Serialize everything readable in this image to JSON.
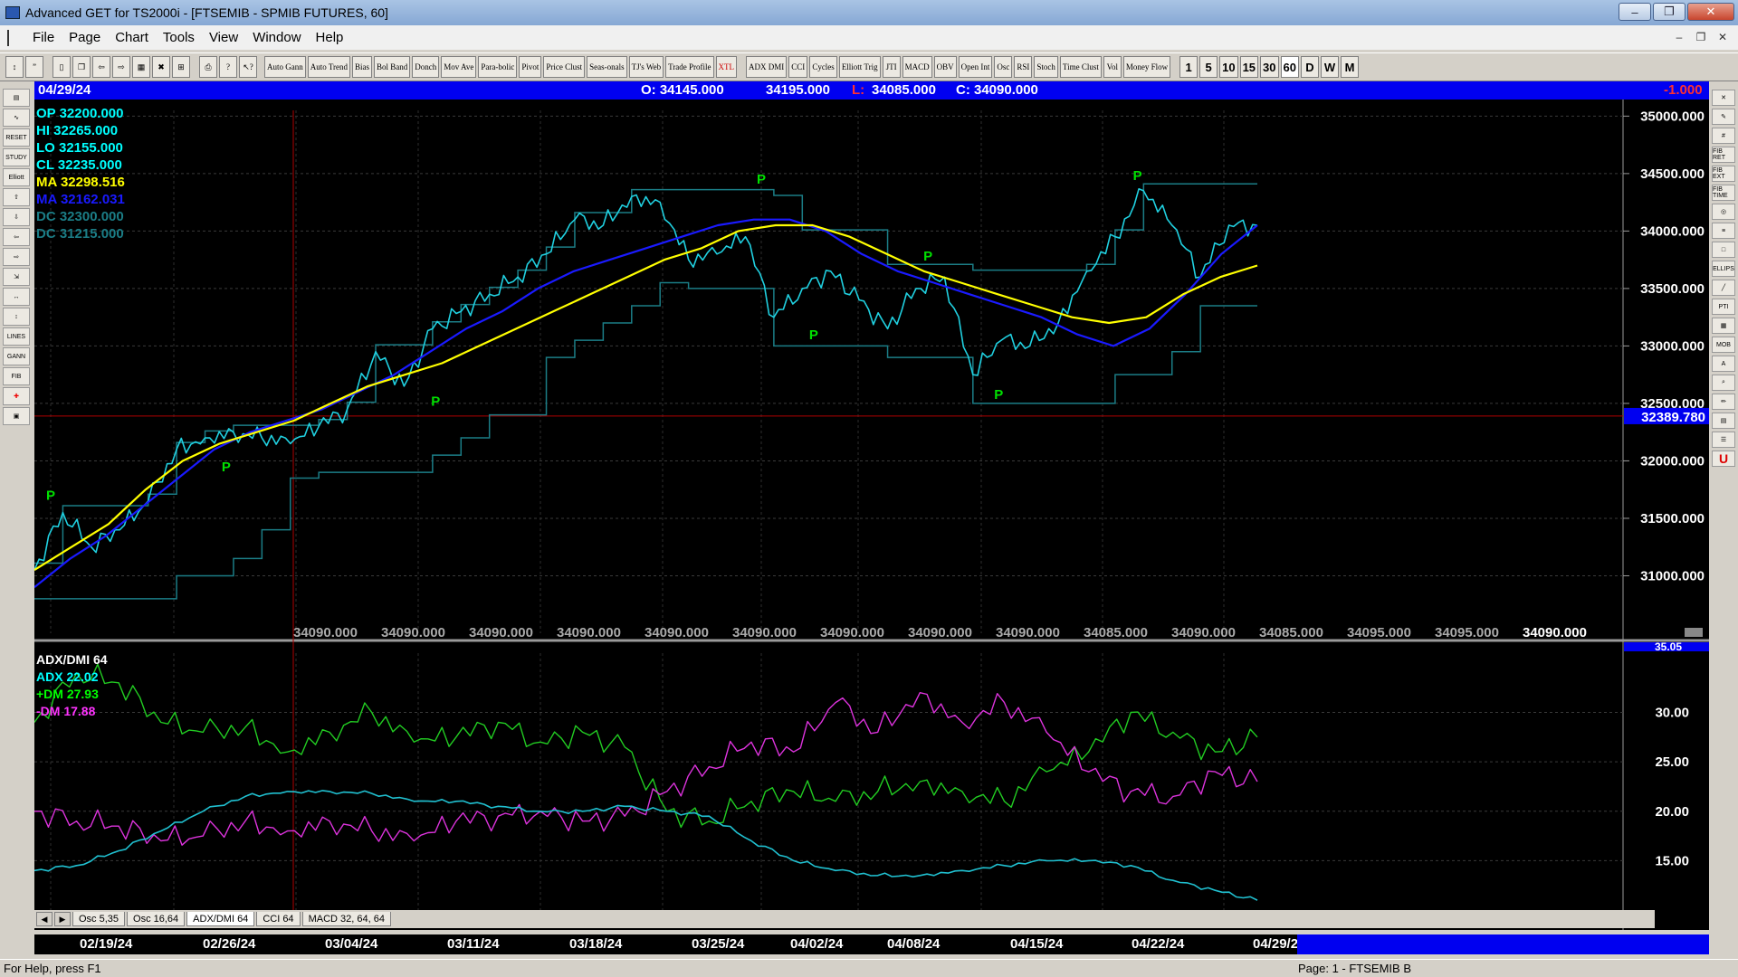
{
  "window": {
    "title": "Advanced GET for TS2000i - [FTSEMIB - SPMIB FUTURES, 60]"
  },
  "menu": [
    "File",
    "Page",
    "Chart",
    "Tools",
    "View",
    "Window",
    "Help"
  ],
  "toolbar": {
    "studies": [
      "Auto Gann",
      "Auto Trend",
      "Bias",
      "Bol Band",
      "Donch",
      "Mov Ave",
      "Para-bolic",
      "Pivot",
      "Price Clust",
      "Seas-onals",
      "TJ's Web",
      "Trade Profile",
      "XTL",
      "ADX DMI",
      "CCI",
      "Cycles",
      "Elliott Trig",
      "JTI",
      "MACD",
      "OBV",
      "Open Int",
      "Osc",
      "RSI",
      "Stoch",
      "Time Clust",
      "Vol",
      "Money Flow"
    ],
    "intervals": [
      "1",
      "5",
      "10",
      "15",
      "30",
      "60",
      "D",
      "W",
      "M"
    ],
    "active_interval": "60"
  },
  "left_tools": [
    "RESET",
    "STUDY",
    "Elliott",
    "LINES",
    "GANN",
    "FIB"
  ],
  "right_tools": [
    "FIB RET",
    "FIB EXT",
    "FIB TIME",
    "ELLIPS",
    "PTI",
    "MOB"
  ],
  "infobar": {
    "date": "04/29/24",
    "open": "O:  34145.000",
    "high": "34195.000",
    "low_label": "L:",
    "low": "34085.000",
    "close": "C:  34090.000",
    "change": "-1.000"
  },
  "legend_price": [
    {
      "label": "OP  32200.000",
      "color": "#00ffff"
    },
    {
      "label": "HI   32265.000",
      "color": "#00ffff"
    },
    {
      "label": "LO  32155.000",
      "color": "#00ffff"
    },
    {
      "label": "CL   32235.000",
      "color": "#00ffff"
    },
    {
      "label": "MA  32298.516",
      "color": "#ffff00"
    },
    {
      "label": "MA  32162.031",
      "color": "#1a1aff"
    },
    {
      "label": "DC  32300.000",
      "color": "#1b7d86"
    },
    {
      "label": "DC  31215.000",
      "color": "#1b7d86"
    }
  ],
  "price_axis": [
    "35000.000",
    "34500.000",
    "34000.000",
    "33500.000",
    "33000.000",
    "32500.000",
    "32000.000",
    "31500.000",
    "31000.000"
  ],
  "crosshair_price": "32389.780",
  "bottom_values": [
    "34090.000",
    "34090.000",
    "34090.000",
    "34090.000",
    "34090.000",
    "34090.000",
    "34090.000",
    "34090.000",
    "34090.000",
    "34085.000",
    "34090.000",
    "34085.000",
    "34095.000",
    "34095.000",
    "34090.000"
  ],
  "legend_adx": [
    {
      "label": "ADX/DMI 64",
      "color": "#ffffff"
    },
    {
      "label": "ADX 22.02",
      "color": "#00ffff"
    },
    {
      "label": "+DM 27.93",
      "color": "#00ff00"
    },
    {
      "label": "-DM  17.88",
      "color": "#ff33ff"
    }
  ],
  "adx_axis": [
    "30.00",
    "25.00",
    "20.00",
    "15.00"
  ],
  "adx_top_value": "35.05",
  "tabs": [
    "Osc 5,35",
    "Osc 16,64",
    "ADX/DMI 64",
    "CCI 64",
    "MACD 32, 64, 64"
  ],
  "active_tab": "ADX/DMI 64",
  "dates": [
    "02/19/24",
    "02/26/24",
    "03/04/24",
    "03/11/24",
    "03/18/24",
    "03/25/24",
    "04/02/24",
    "04/08/24",
    "04/15/24",
    "04/22/24",
    "04/29/24"
  ],
  "pivot_label": "P",
  "status": {
    "help": "For Help, press F1",
    "page": "Page: 1 - FTSEMIB B"
  },
  "chart_data": {
    "type": "line",
    "price_range": [
      30500,
      35050
    ],
    "pivots": [
      {
        "date": "02/19/24",
        "kind": "high",
        "value": 31600
      },
      {
        "date": "02/29/24",
        "kind": "low",
        "value": 32050
      },
      {
        "date": "03/12/24",
        "kind": "low",
        "value": 32620
      },
      {
        "date": "04/02/24",
        "kind": "high",
        "value": 34350
      },
      {
        "date": "04/05/24",
        "kind": "low",
        "value": 33200
      },
      {
        "date": "04/12/24",
        "kind": "high",
        "value": 33680
      },
      {
        "date": "04/16/24",
        "kind": "low",
        "value": 32680
      },
      {
        "date": "04/24/24",
        "kind": "high",
        "value": 34380
      }
    ],
    "series": [
      {
        "name": "CL",
        "values": [
          31050,
          31550,
          31250,
          31400,
          31650,
          32100,
          32200,
          32250,
          32200,
          32150,
          32300,
          32450,
          32950,
          32650,
          33150,
          33300,
          33450,
          33600,
          33800,
          34100,
          34050,
          34300,
          34250,
          33750,
          33800,
          33950,
          33250,
          33500,
          33650,
          33400,
          33150,
          33500,
          33600,
          32750,
          33050,
          33000,
          33200,
          33650,
          33950,
          34350,
          34050,
          33600,
          34050,
          34050
        ]
      },
      {
        "name": "MA",
        "values": [
          31050,
          31250,
          31450,
          31750,
          32000,
          32150,
          32250,
          32350,
          32500,
          32650,
          32750,
          32850,
          33000,
          33150,
          33300,
          33450,
          33600,
          33750,
          33850,
          34000,
          34050,
          34050,
          33950,
          33800,
          33650,
          33550,
          33450,
          33350,
          33250,
          33200,
          33250,
          33450,
          33600,
          33700
        ]
      },
      {
        "name": "MA",
        "values": [
          30900,
          31150,
          31350,
          31600,
          31850,
          32100,
          32250,
          32350,
          32450,
          32600,
          32750,
          32950,
          33150,
          33300,
          33500,
          33650,
          33750,
          33850,
          33950,
          34050,
          34100,
          34100,
          34000,
          33800,
          33650,
          33550,
          33450,
          33350,
          33250,
          33100,
          33000,
          33150,
          33450,
          33800,
          34050
        ]
      },
      {
        "name": "ADX",
        "values": [
          14.0,
          14.5,
          16.0,
          18.0,
          20.0,
          21.5,
          22.0,
          22.0,
          21.8,
          21.0,
          21.0,
          20.5,
          20.0,
          20.0,
          20.5,
          20.0,
          19.5,
          17.0,
          15.0,
          14.0,
          13.5,
          13.5,
          14.0,
          14.5,
          15.0,
          15.0,
          14.5,
          13.0,
          12.0,
          11.0
        ]
      },
      {
        "name": "+DM",
        "values": [
          29.0,
          34.0,
          33.0,
          29.0,
          28.0,
          28.5,
          26.0,
          28.0,
          30.0,
          27.0,
          27.5,
          29.0,
          27.0,
          28.0,
          26.5,
          20.0,
          19.0,
          21.0,
          22.0,
          21.0,
          22.0,
          23.0,
          22.0,
          21.0,
          24.0,
          26.0,
          30.0,
          28.0,
          26.0,
          27.5
        ]
      },
      {
        "name": "-DM",
        "values": [
          20.0,
          19.0,
          18.5,
          17.0,
          17.5,
          19.0,
          18.0,
          19.0,
          18.0,
          17.0,
          19.0,
          19.5,
          20.0,
          19.0,
          19.5,
          22.0,
          24.5,
          27.0,
          26.0,
          31.0,
          28.0,
          32.0,
          29.0,
          31.0,
          28.0,
          24.0,
          22.0,
          21.5,
          24.0,
          23.0
        ]
      }
    ]
  }
}
